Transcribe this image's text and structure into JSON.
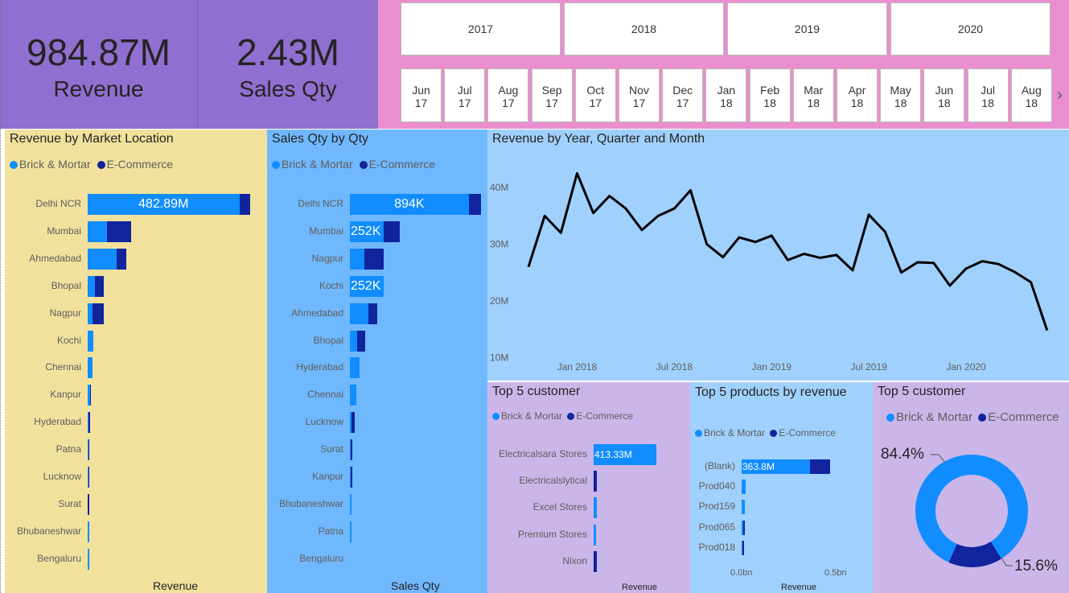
{
  "colors": {
    "brick": "#118dff",
    "ecom": "#12239e",
    "kpi_bg": "#8f6fcf",
    "slicer_bg": "#ea8ecf",
    "panel_yellow": "#f1e19d",
    "panel_blue": "#70b8fd",
    "panel_lightblue": "#a0d0fd",
    "panel_lilac": "#cab6e9"
  },
  "kpis": [
    {
      "value": "984.87M",
      "label": "Revenue"
    },
    {
      "value": "2.43M",
      "label": "Sales Qty"
    }
  ],
  "year_slicer": [
    "2017",
    "2018",
    "2019",
    "2020"
  ],
  "month_slicer": [
    {
      "m": "Jun",
      "y": "17"
    },
    {
      "m": "Jul",
      "y": "17"
    },
    {
      "m": "Aug",
      "y": "17"
    },
    {
      "m": "Sep",
      "y": "17"
    },
    {
      "m": "Oct",
      "y": "17"
    },
    {
      "m": "Nov",
      "y": "17"
    },
    {
      "m": "Dec",
      "y": "17"
    },
    {
      "m": "Jan",
      "y": "18"
    },
    {
      "m": "Feb",
      "y": "18"
    },
    {
      "m": "Mar",
      "y": "18"
    },
    {
      "m": "Apr",
      "y": "18"
    },
    {
      "m": "May",
      "y": "18"
    },
    {
      "m": "Jun",
      "y": "18"
    },
    {
      "m": "Jul",
      "y": "18"
    },
    {
      "m": "Aug",
      "y": "18"
    }
  ],
  "next_icon": "chevron-right-icon",
  "legend": {
    "brick": "Brick & Mortar",
    "ecom": "E-Commerce"
  },
  "chart_data": [
    {
      "type": "bar",
      "title": "Revenue by Market Location",
      "xlabel": "Revenue",
      "categories": [
        "Delhi NCR",
        "Mumbai",
        "Ahmedabad",
        "Bhopal",
        "Nagpur",
        "Kochi",
        "Chennai",
        "Kanpur",
        "Hyderabad",
        "Patna",
        "Lucknow",
        "Surat",
        "Bhubaneshwar",
        "Bengaluru"
      ],
      "series": [
        {
          "name": "Brick & Mortar",
          "values": [
            482.89,
            61,
            92,
            22,
            15,
            17,
            15,
            7,
            3,
            2,
            1.5,
            1,
            0.5,
            0.2
          ]
        },
        {
          "name": "E-Commerce",
          "values": [
            35,
            78,
            30,
            30,
            35,
            0,
            0,
            3,
            1,
            1,
            1,
            1,
            0,
            0
          ]
        }
      ],
      "data_labels": [
        "482.89M",
        "",
        "",
        "",
        "",
        "",
        "",
        "",
        "",
        "",
        "",
        "",
        "",
        ""
      ]
    },
    {
      "type": "bar",
      "title": "Sales Qty by Qty",
      "xlabel": "Sales Qty",
      "categories": [
        "Delhi NCR",
        "Mumbai",
        "Nagpur",
        "Kochi",
        "Ahmedabad",
        "Bhopal",
        "Hyderabad",
        "Chennai",
        "Lucknow",
        "Surat",
        "Kanpur",
        "Bhubaneshwar",
        "Patna",
        "Bengaluru"
      ],
      "series": [
        {
          "name": "Brick & Mortar",
          "values": [
            894,
            252,
            110,
            252,
            140,
            55,
            75,
            50,
            12,
            8,
            8,
            6,
            4,
            0
          ]
        },
        {
          "name": "E-Commerce",
          "values": [
            90,
            125,
            145,
            0,
            65,
            60,
            0,
            0,
            22,
            10,
            5,
            0,
            0,
            0
          ]
        }
      ],
      "data_labels": [
        "894K",
        "252K",
        "",
        "252K",
        "",
        "",
        "",
        "",
        "",
        "",
        "",
        "",
        "",
        ""
      ]
    },
    {
      "type": "line",
      "title": "Revenue by Year, Quarter and Month",
      "x_ticks": [
        "Jan 2018",
        "Jul 2018",
        "Jan 2019",
        "Jul 2019",
        "Jan 2020"
      ],
      "y_ticks": [
        "40M",
        "30M",
        "20M",
        "10M"
      ],
      "ylim": [
        10,
        43
      ],
      "x": [
        "2017-10",
        "2017-11",
        "2017-12",
        "2018-01",
        "2018-02",
        "2018-03",
        "2018-04",
        "2018-05",
        "2018-06",
        "2018-07",
        "2018-08",
        "2018-09",
        "2018-10",
        "2018-11",
        "2018-12",
        "2019-01",
        "2019-02",
        "2019-03",
        "2019-04",
        "2019-05",
        "2019-06",
        "2019-07",
        "2019-08",
        "2019-09",
        "2019-10",
        "2019-11",
        "2019-12",
        "2020-01",
        "2020-02",
        "2020-03",
        "2020-04",
        "2020-05",
        "2020-06"
      ],
      "y": [
        26,
        35,
        32,
        42.5,
        35.5,
        38.5,
        36.3,
        32.5,
        35,
        36.3,
        39.5,
        30,
        27.7,
        31.2,
        30.4,
        31.5,
        27.2,
        28.3,
        27.6,
        28.1,
        25.4,
        35.2,
        32.2,
        25,
        26.8,
        26.7,
        22.7,
        25.7,
        27,
        26.5,
        25.1,
        23.3,
        14.8
      ]
    },
    {
      "type": "bar",
      "title": "Top 5 customer",
      "xlabel": "Revenue",
      "categories": [
        "Electricalsara Stores",
        "Electricalslytical",
        "Excel Stores",
        "Premium Stores",
        "Nixon"
      ],
      "series": [
        {
          "name": "Brick & Mortar",
          "values": [
            413.33,
            0,
            20,
            18,
            0
          ]
        },
        {
          "name": "E-Commerce",
          "values": [
            0,
            20,
            0,
            0,
            20
          ]
        }
      ],
      "data_labels": [
        "413.33M",
        "",
        "",
        "",
        ""
      ]
    },
    {
      "type": "bar",
      "title": "Top 5 products by revenue",
      "xlabel": "Revenue",
      "x_ticks": [
        "0.0bn",
        "0.5bn"
      ],
      "categories": [
        "(Blank)",
        "Prod040",
        "Prod159",
        "Prod065",
        "Prod018"
      ],
      "series": [
        {
          "name": "Brick & Mortar",
          "values": [
            363.8,
            20,
            15,
            10,
            6
          ]
        },
        {
          "name": "E-Commerce",
          "values": [
            106,
            0,
            0,
            5,
            5
          ]
        }
      ],
      "data_labels": [
        "363.8M",
        "",
        "",
        "",
        ""
      ]
    },
    {
      "type": "pie",
      "title": "Top 5 customer",
      "slices": [
        {
          "name": "Brick & Mortar",
          "value": 84.4,
          "label": "84.4%"
        },
        {
          "name": "E-Commerce",
          "value": 15.6,
          "label": "15.6%"
        }
      ]
    }
  ]
}
